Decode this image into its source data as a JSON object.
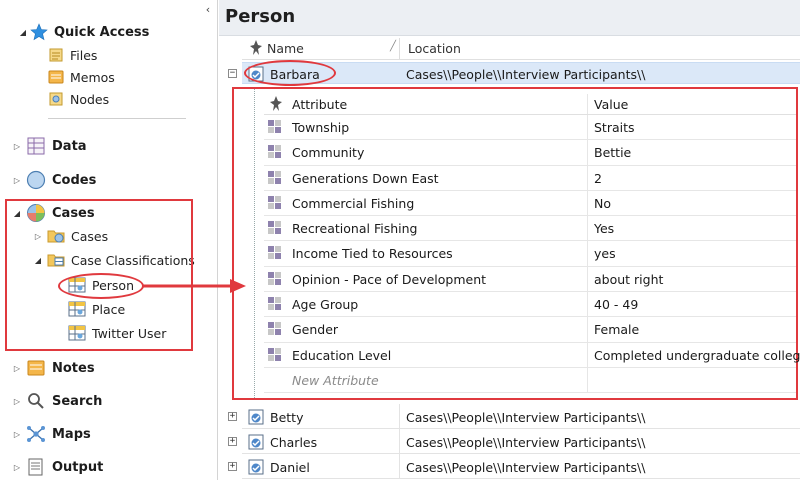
{
  "sidebar": {
    "collapse_glyph": "‹",
    "quick_access": {
      "label": "Quick Access",
      "items": [
        "Files",
        "Memos",
        "Nodes"
      ]
    },
    "sections": [
      {
        "label": "Data"
      },
      {
        "label": "Codes"
      },
      {
        "label": "Cases"
      },
      {
        "label": "Notes"
      },
      {
        "label": "Search"
      },
      {
        "label": "Maps"
      },
      {
        "label": "Output"
      }
    ],
    "cases_children": {
      "cases": "Cases",
      "case_classifications": "Case Classifications"
    },
    "classifications": [
      "Person",
      "Place",
      "Twitter User"
    ]
  },
  "main": {
    "title": "Person",
    "columns": {
      "name": "Name",
      "location": "Location"
    },
    "rows": [
      {
        "name": "Barbara",
        "location": "Cases\\\\People\\\\Interview Participants\\\\"
      },
      {
        "name": "Betty",
        "location": "Cases\\\\People\\\\Interview Participants\\\\"
      },
      {
        "name": "Charles",
        "location": "Cases\\\\People\\\\Interview Participants\\\\"
      },
      {
        "name": "Daniel",
        "location": "Cases\\\\People\\\\Interview Participants\\\\"
      }
    ],
    "attributes": {
      "headers": {
        "attribute": "Attribute",
        "value": "Value"
      },
      "rows": [
        {
          "attribute": "Township",
          "value": "Straits"
        },
        {
          "attribute": "Community",
          "value": "Bettie"
        },
        {
          "attribute": "Generations Down East",
          "value": "2"
        },
        {
          "attribute": "Commercial Fishing",
          "value": "No"
        },
        {
          "attribute": "Recreational Fishing",
          "value": "Yes"
        },
        {
          "attribute": "Income Tied to Resources",
          "value": "yes"
        },
        {
          "attribute": "Opinion - Pace of Development",
          "value": "about right"
        },
        {
          "attribute": "Age Group",
          "value": "40 - 49"
        },
        {
          "attribute": "Gender",
          "value": "Female"
        },
        {
          "attribute": "Education Level",
          "value": "Completed undergraduate college"
        }
      ],
      "new_attribute_placeholder": "New Attribute"
    }
  },
  "colors": {
    "annotation_red": "#e0393e",
    "selection_blue": "#dbe8f8"
  }
}
